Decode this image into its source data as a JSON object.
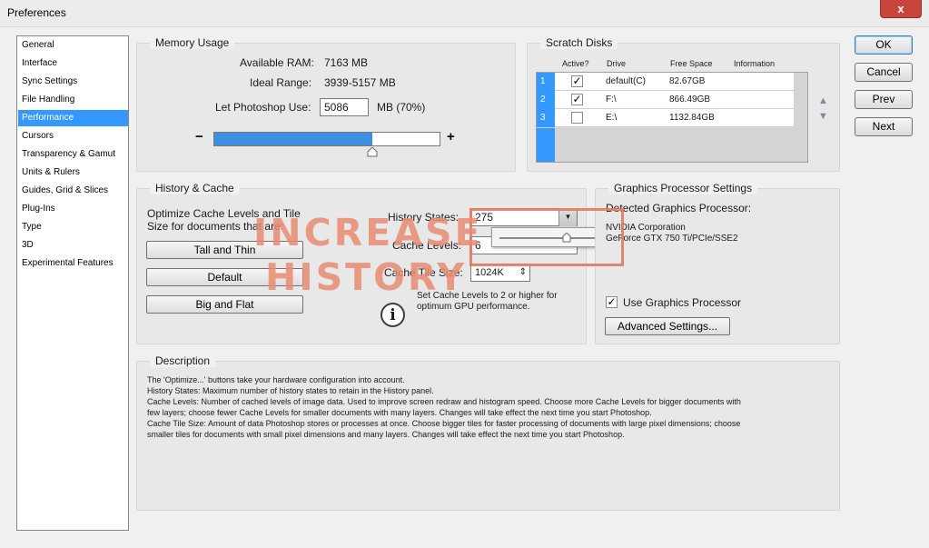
{
  "window": {
    "title": "Preferences",
    "close_label": "x"
  },
  "sidebar": {
    "items": [
      {
        "label": "General"
      },
      {
        "label": "Interface"
      },
      {
        "label": "Sync Settings"
      },
      {
        "label": "File Handling"
      },
      {
        "label": "Performance",
        "selected": true
      },
      {
        "label": "Cursors"
      },
      {
        "label": "Transparency & Gamut"
      },
      {
        "label": "Units & Rulers"
      },
      {
        "label": "Guides, Grid & Slices"
      },
      {
        "label": "Plug-Ins"
      },
      {
        "label": "Type"
      },
      {
        "label": "3D"
      },
      {
        "label": "Experimental Features"
      }
    ]
  },
  "memory": {
    "title": "Memory Usage",
    "available_label": "Available RAM:",
    "available_value": "7163 MB",
    "ideal_label": "Ideal Range:",
    "ideal_value": "3939-5157 MB",
    "use_label": "Let Photoshop Use:",
    "use_value": "5086",
    "use_unit": "MB (70%)",
    "minus": "−",
    "plus": "+",
    "slider_fraction": 0.7
  },
  "scratch": {
    "title": "Scratch Disks",
    "headers": [
      "Active?",
      "Drive",
      "Free Space",
      "Information"
    ],
    "rows": [
      {
        "index": "1",
        "active": true,
        "drive": "default(C)",
        "free": "82.67GB"
      },
      {
        "index": "2",
        "active": true,
        "drive": "F:\\",
        "free": "866.49GB"
      },
      {
        "index": "3",
        "active": false,
        "drive": "E:\\",
        "free": "1132.84GB"
      }
    ],
    "up_arrow": "▲",
    "down_arrow": "▼"
  },
  "history": {
    "title": "History & Cache",
    "optimize_line1": "Optimize Cache Levels and Tile",
    "optimize_line2": "Size for documents that are:",
    "btn_tall": "Tall and Thin",
    "btn_default": "Default",
    "btn_big": "Big and Flat",
    "states_label": "History States:",
    "states_value": "275",
    "cache_label": "Cache Levels:",
    "cache_value": "6",
    "tile_label": "Cache Tile Size:",
    "tile_value": "1024K",
    "hint_line1": "Set Cache Levels to 2 or higher for",
    "hint_line2": "optimum GPU performance.",
    "info_glyph": "i",
    "dropdown_glyph": "▼",
    "spin_glyph": "⇕",
    "popup_slider_fraction": 0.7
  },
  "overlay": {
    "line1": "INCREASE",
    "line2": "HISTORY"
  },
  "gpu": {
    "title": "Graphics Processor Settings",
    "detected_label": "Detected Graphics Processor:",
    "vendor": "NVIDIA Corporation",
    "model": "GeForce GTX 750 Ti/PCIe/SSE2",
    "use_label": "Use Graphics Processor",
    "use_checked": true,
    "advanced_label": "Advanced Settings..."
  },
  "description": {
    "title": "Description",
    "lines": [
      "The 'Optimize...' buttons take your hardware configuration into account.",
      "History States: Maximum number of history states to retain in the History panel.",
      "Cache Levels: Number of cached levels of image data.  Used to improve screen redraw and histogram speed.  Choose more Cache Levels for bigger documents with",
      "few layers; choose fewer Cache Levels for smaller documents with many layers. Changes will take effect the next time you start Photoshop.",
      "Cache Tile Size: Amount of data Photoshop stores or processes at once. Choose bigger tiles for faster processing of documents with large pixel dimensions; choose",
      "smaller tiles for documents with small pixel dimensions and many layers. Changes will take effect the next time you start Photoshop."
    ]
  },
  "actions": {
    "ok": "OK",
    "cancel": "Cancel",
    "prev": "Prev",
    "next": "Next"
  },
  "colors": {
    "selection": "#3399ff",
    "slider_fill": "#3d8fe0",
    "overlay": "#e07a5f"
  }
}
